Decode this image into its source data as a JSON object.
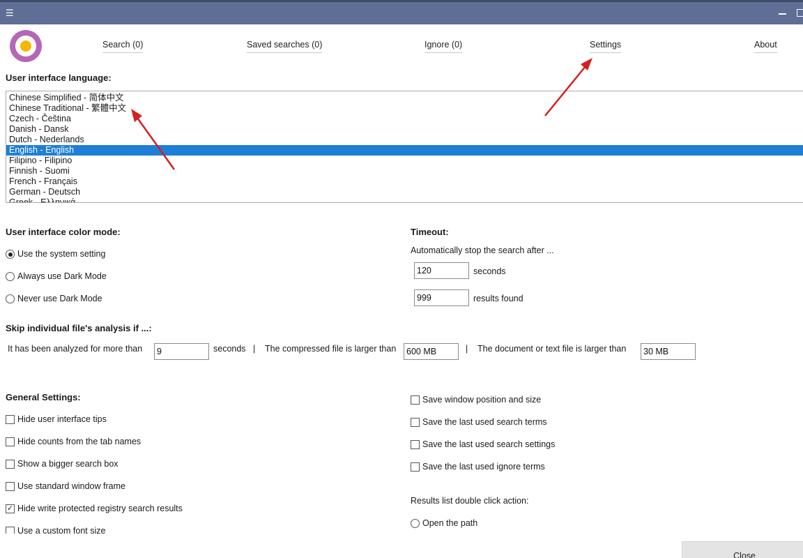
{
  "titlebar": {
    "menu_icon": "☰"
  },
  "tabs": [
    {
      "label": "Search (0)"
    },
    {
      "label": "Saved searches (0)"
    },
    {
      "label": "Ignore (0)"
    },
    {
      "label": "Settings"
    },
    {
      "label": "About"
    }
  ],
  "language": {
    "title": "User interface language:",
    "items": [
      "Chinese Simplified - 简体中文",
      "Chinese Traditional - 繁體中文",
      "Czech - Čeština",
      "Danish - Dansk",
      "Dutch - Nederlands",
      "English - English",
      "Filipino - Filipino",
      "Finnish - Suomi",
      "French - Français",
      "German - Deutsch",
      "Greek - Ελληνικά"
    ],
    "selected_index": 5,
    "selected_color": "#1e7fd6"
  },
  "color_mode": {
    "title": "User interface color mode:",
    "options": [
      "Use the system setting",
      "Always use Dark Mode",
      "Never use Dark Mode"
    ],
    "selected_index": 0
  },
  "timeout": {
    "title": "Timeout:",
    "description": "Automatically stop the search after ...",
    "seconds_value": "120",
    "seconds_label": "seconds",
    "results_value": "999",
    "results_label": "results found"
  },
  "skip": {
    "title": "Skip individual file's analysis if ...:",
    "analyzed_label": "It has been analyzed for more than",
    "analyzed_value": "9",
    "seconds_label": "seconds",
    "separator": "|",
    "compressed_label": "The compressed file is larger than",
    "compressed_value": "600 MB",
    "document_label": "The document or text file is larger than",
    "document_value": "30 MB"
  },
  "general": {
    "title": "General Settings:",
    "left": [
      {
        "label": "Hide user interface tips",
        "checked": false
      },
      {
        "label": "Hide counts from the tab names",
        "checked": false
      },
      {
        "label": "Show a bigger search box",
        "checked": false
      },
      {
        "label": "Use standard window frame",
        "checked": false
      },
      {
        "label": "Hide write protected registry search results",
        "checked": true
      },
      {
        "label": "Use a custom font size",
        "checked": false
      }
    ],
    "right": [
      {
        "label": "Save window position and size",
        "checked": false
      },
      {
        "label": "Save the last used search terms",
        "checked": false
      },
      {
        "label": "Save the last used search settings",
        "checked": false
      },
      {
        "label": "Save the last used ignore terms",
        "checked": false
      }
    ],
    "double_click_title": "Results list double click action:",
    "double_click_option": "Open the path"
  },
  "close_label": "Close",
  "annotation_color": "#d42020"
}
